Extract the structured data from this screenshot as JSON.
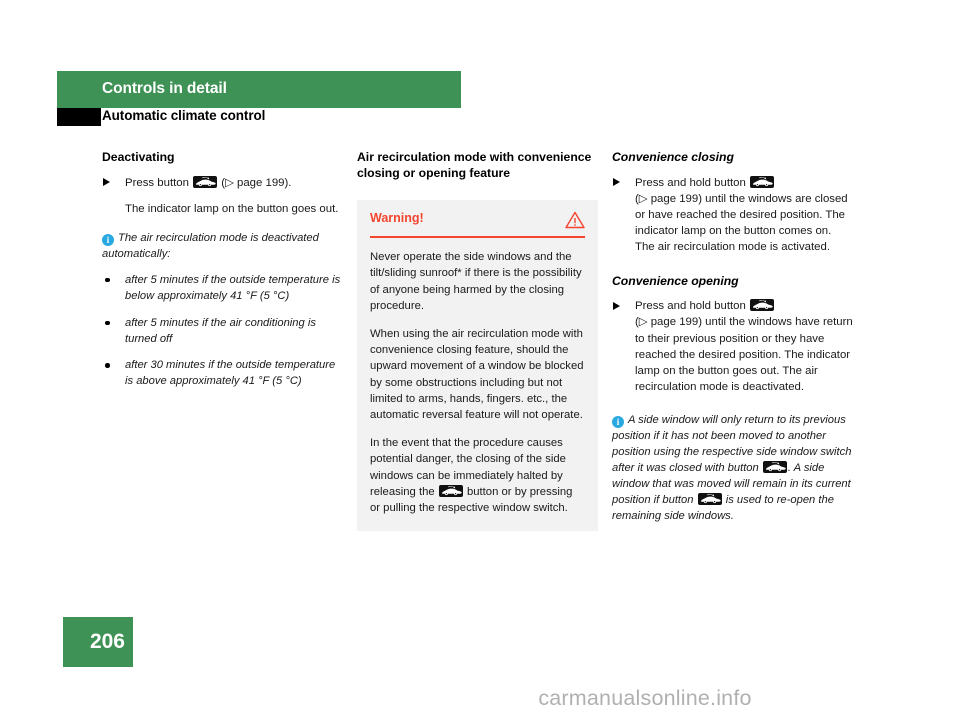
{
  "header": {
    "chapter": "Controls in detail",
    "section": "Automatic climate control"
  },
  "icons": {
    "recirc_button": "air-recirculation-car-button-icon",
    "info": "info-icon",
    "warning": "warning-triangle-icon",
    "bullet_step": "triangle-bullet-icon"
  },
  "colors": {
    "green": "#3f9255",
    "red": "#f4452f",
    "info_blue": "#2aa9e0",
    "warn_bg": "#f2f2f2",
    "black": "#000000"
  },
  "col1": {
    "heading": "Deactivating",
    "step_pre": "Press button ",
    "step_post": " (▷ page 199).",
    "result": "The indicator lamp on the button goes out.",
    "note_intro": "The air recirculation mode is deactivated automatically:",
    "note_bullets": [
      "after 5 minutes if the outside temperature is below approximately 41 °F (5 °C)",
      "after 5 minutes if the air conditioning is turned off",
      "after 30 minutes if the outside temperature is above approximately 41 °F (5 °C)"
    ]
  },
  "col2": {
    "heading": "Air recirculation mode with convenience closing or opening feature",
    "warning": {
      "label": "Warning!",
      "paragraphs": [
        "Never operate the side windows and the tilt/sliding sunroof* if there is the possibility of anyone being harmed by the closing procedure.",
        "When using the air recirculation mode with convenience closing feature, should the upward movement of a window be blocked by some obstructions including but not limited to arms, hands, fingers. etc., the automatic reversal feature will not operate.",
        "In the event that the procedure causes potential danger, the closing of the side windows can be immediately halted by releasing the ",
        " button or by pressing or pulling the respective window switch."
      ]
    }
  },
  "col3": {
    "closing": {
      "heading": "Convenience closing",
      "step_pre": "Press and hold button ",
      "step_post": "(▷ page 199) until the windows are closed or have reached the desired position. The indicator lamp on the button comes on. The air recirculation mode is activated."
    },
    "opening": {
      "heading": "Convenience opening",
      "step_pre": "Press and hold button ",
      "step_post": "(▷ page 199) until the windows have return to their previous position or they have reached the desired position. The indicator lamp on the button goes out. The air recirculation mode is deactivated."
    },
    "note": {
      "part1": "A side window will only return to its previous position if it has not been moved to another position using the respective side window switch after it was closed with button ",
      "part2": ". A side window that was moved will remain in its current position if button ",
      "part3": " is used to re-open the remaining side windows."
    }
  },
  "footer": {
    "page_number": "206",
    "watermark": "carmanualsonline.info"
  }
}
